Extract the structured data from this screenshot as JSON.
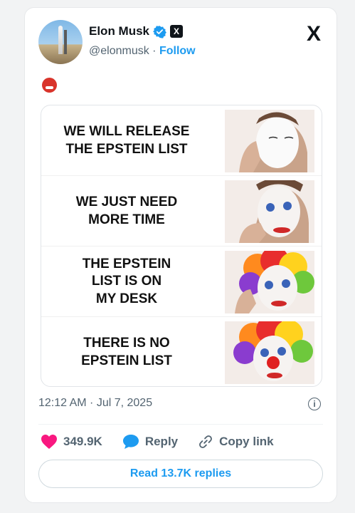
{
  "author": {
    "name": "Elon Musk",
    "handle": "@elonmusk",
    "separator": "·",
    "follow_label": "Follow",
    "verified_badge_color": "#1d9bf0",
    "affiliate_badge": "X",
    "avatar_icon": "starship-launch-photo"
  },
  "header": {
    "platform_logo": "X"
  },
  "post": {
    "emoji": "angry-face-with-symbols-on-mouth",
    "meme_panels": [
      {
        "text": "WE WILL RELEASE\nTHE EPSTEIN LIST",
        "face": "white-face-paint"
      },
      {
        "text": "WE JUST NEED\nMORE TIME",
        "face": "clown-makeup-partial"
      },
      {
        "text": "THE EPSTEIN\nLIST IS ON\nMY DESK",
        "face": "clown-wig-on"
      },
      {
        "text": "THERE IS NO\nEPSTEIN LIST",
        "face": "full-clown"
      }
    ],
    "timestamp": "12:12 AM · Jul 7, 2025"
  },
  "actions": {
    "likes": "349.9K",
    "reply_label": "Reply",
    "copy_link_label": "Copy link",
    "read_replies_label": "Read 13.7K replies"
  },
  "colors": {
    "accent": "#1d9bf0",
    "like": "#f91880",
    "text_secondary": "#536471"
  }
}
